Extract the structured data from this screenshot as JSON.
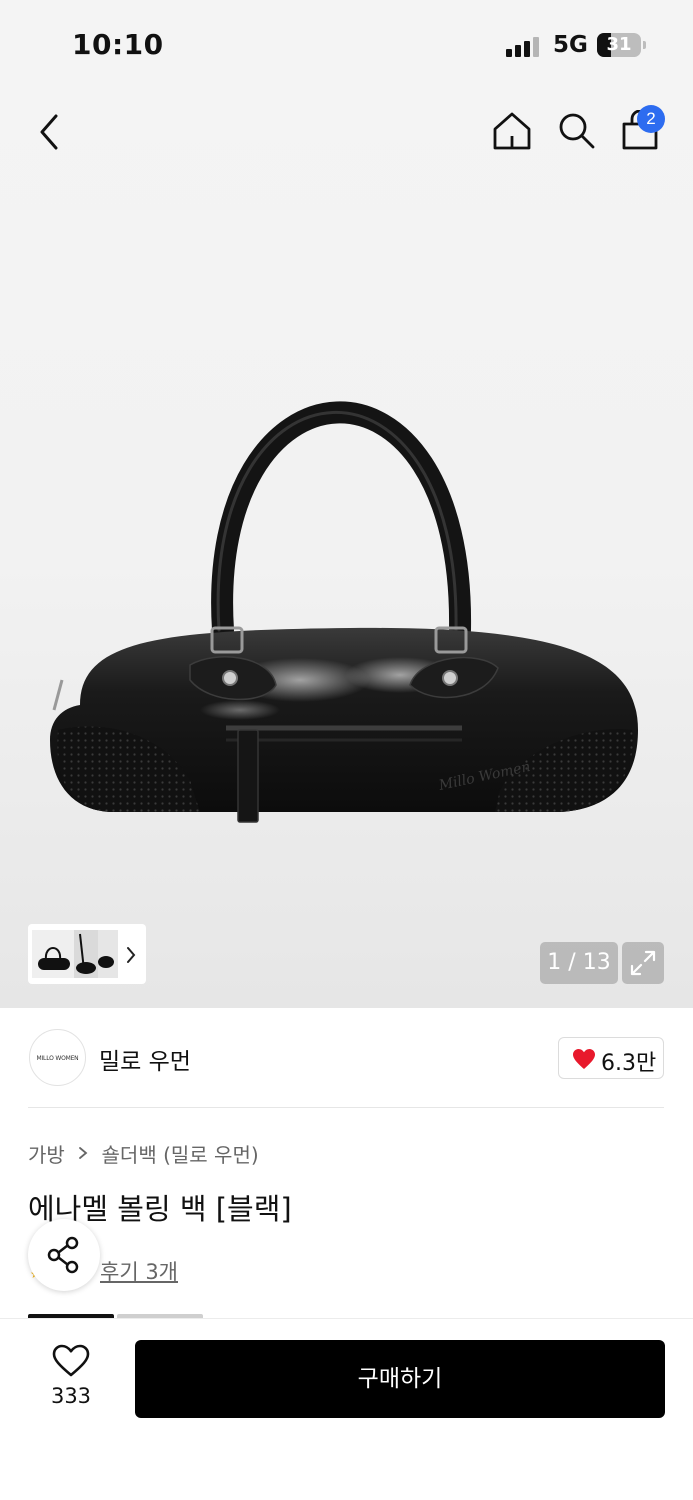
{
  "status_bar": {
    "time": "10:10",
    "network": "5G",
    "battery": "31",
    "battery_level": 0.31
  },
  "nav": {
    "cart_count": "2"
  },
  "gallery": {
    "counter": "1 / 13"
  },
  "brand": {
    "logo_text": "MILLO WOMEN",
    "name": "밀로 우먼",
    "like_count": "6.3만"
  },
  "breadcrumb": {
    "category": "가방",
    "subcategory": "숄더백 (밀로 우먼)"
  },
  "product": {
    "title": "에나멜 볼링 백 [블랙]",
    "review_link": "후기 3개"
  },
  "bottom_bar": {
    "wish_count": "333",
    "buy_label": "구매하기"
  },
  "colors": {
    "accent": "#2d6cf0",
    "like_red": "#e8192c",
    "primary_button": "#000000"
  }
}
